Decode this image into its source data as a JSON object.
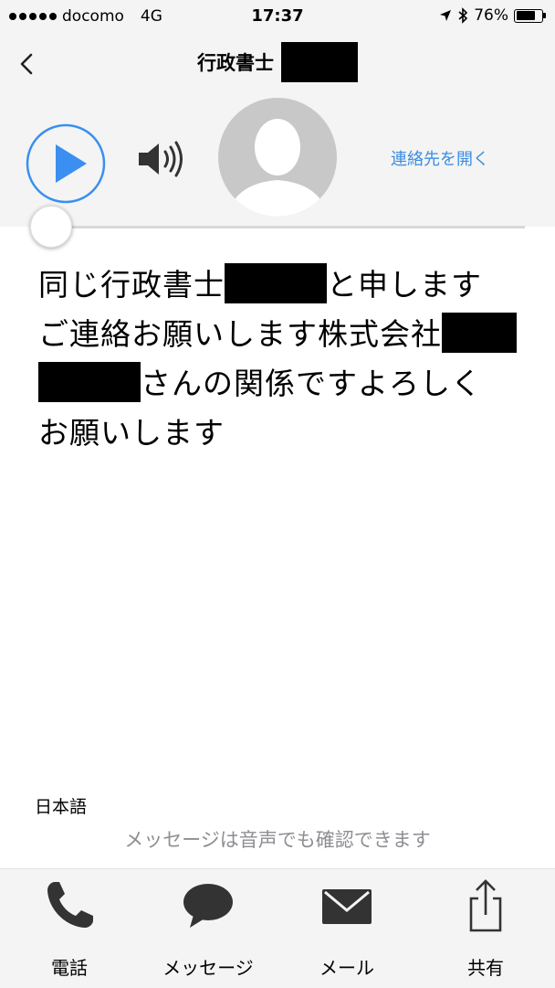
{
  "status_bar": {
    "carrier": "docomo",
    "network": "4G",
    "time": "17:37",
    "battery": "76%",
    "battery_level": 0.76,
    "icons": [
      "signal-dots-icon",
      "location-arrow-icon",
      "bluetooth-icon",
      "battery-icon"
    ]
  },
  "header": {
    "title": "行政書士",
    "open_contact_label": "連絡先を開く",
    "icons": [
      "chevron-left-icon",
      "play-icon",
      "speaker-icon",
      "avatar-silhouette-icon"
    ]
  },
  "player": {
    "progress": 0
  },
  "transcript": {
    "line1_pre": "同じ行政書士",
    "line1_post": "と申します",
    "line2": "ご連絡お願いします株式会社",
    "line3_post": "さんの関係ですよろしく",
    "line4": "お願いします"
  },
  "language": "日本語",
  "hint": "メッセージは音声でも確認できます",
  "tabbar": {
    "items": [
      {
        "label": "電話",
        "icon": "phone-icon"
      },
      {
        "label": "メッセージ",
        "icon": "chat-bubble-icon"
      },
      {
        "label": "メール",
        "icon": "envelope-icon"
      },
      {
        "label": "共有",
        "icon": "share-icon"
      }
    ]
  },
  "colors": {
    "accent": "#3d8de0",
    "play": "#3a8ff0",
    "header_bg": "#f4f4f4",
    "hint_text": "#8e8e93",
    "icon_dark": "#333333"
  }
}
